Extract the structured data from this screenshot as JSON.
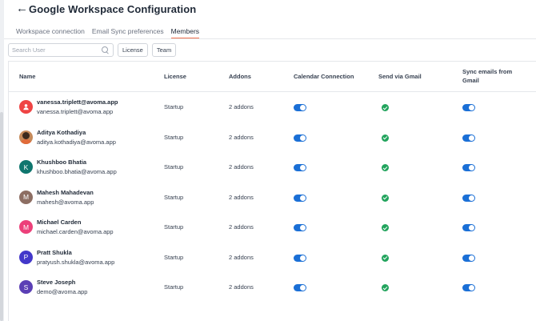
{
  "header": {
    "back_icon": "arrow-left-icon",
    "title": "Google Workspace Configuration"
  },
  "tabs": [
    {
      "label": "Workspace connection",
      "active": false
    },
    {
      "label": "Email Sync preferences",
      "active": false
    },
    {
      "label": "Members",
      "active": true
    }
  ],
  "accent_color": "#f0724f",
  "filters": {
    "search_placeholder": "Search User",
    "license_label": "License",
    "team_label": "Team"
  },
  "table": {
    "columns": {
      "name": "Name",
      "license": "License",
      "addons": "Addons",
      "calendar": "Calendar Connection",
      "gmail": "Send via Gmail",
      "sync_line1": "Sync emails from",
      "sync_line2": "Gmail"
    },
    "rows": [
      {
        "name": "vanessa.triplett@avoma.app",
        "email": "vanessa.triplett@avoma.app",
        "avatar": "user-icon",
        "avatar_color": "#ef4444",
        "license": "Startup",
        "addons": "2 addons",
        "calendar_on": true,
        "gmail_ok": true,
        "sync_on": true
      },
      {
        "name": "Aditya Kothadiya",
        "email": "aditya.kothadiya@avoma.app",
        "avatar": "photo",
        "avatar_color": "#c58a5a",
        "license": "Startup",
        "addons": "2 addons",
        "calendar_on": true,
        "gmail_ok": true,
        "sync_on": true
      },
      {
        "name": "Khushboo Bhatia",
        "email": "khushboo.bhatia@avoma.app",
        "avatar": "K",
        "avatar_color": "#0f766e",
        "license": "Startup",
        "addons": "2 addons",
        "calendar_on": true,
        "gmail_ok": true,
        "sync_on": true
      },
      {
        "name": "Mahesh Mahadevan",
        "email": "mahesh@avoma.app",
        "avatar": "M",
        "avatar_color": "#8d6e63",
        "license": "Startup",
        "addons": "2 addons",
        "calendar_on": true,
        "gmail_ok": true,
        "sync_on": true
      },
      {
        "name": "Michael Carden",
        "email": "michael.carden@avoma.app",
        "avatar": "M",
        "avatar_color": "#ec407a",
        "license": "Startup",
        "addons": "2 addons",
        "calendar_on": true,
        "gmail_ok": true,
        "sync_on": true
      },
      {
        "name": "Pratt Shukla",
        "email": "pratyush.shukla@avoma.app",
        "avatar": "P",
        "avatar_color": "#4338ca",
        "license": "Startup",
        "addons": "2 addons",
        "calendar_on": true,
        "gmail_ok": true,
        "sync_on": true
      },
      {
        "name": "Steve Joseph",
        "email": "demo@avoma.app",
        "avatar": "S",
        "avatar_color": "#5b3fb5",
        "license": "Startup",
        "addons": "2 addons",
        "calendar_on": true,
        "gmail_ok": true,
        "sync_on": true
      }
    ]
  }
}
